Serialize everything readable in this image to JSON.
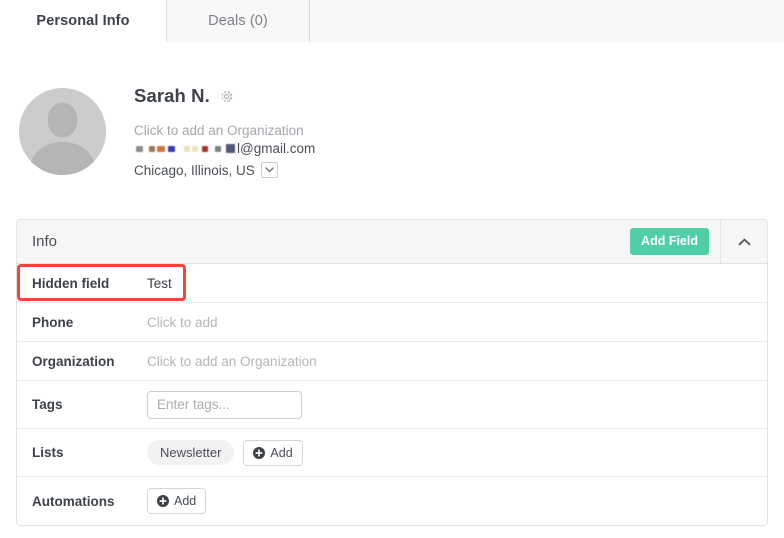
{
  "tabs": [
    {
      "label": "Personal Info",
      "active": true
    },
    {
      "label": "Deals (0)",
      "active": false
    }
  ],
  "profile": {
    "name": "Sarah N.",
    "settings_icon": "gear-icon",
    "organization_placeholder": "Click to add an Organization",
    "email_visible": "l@gmail.com",
    "location": "Chicago, Illinois, US",
    "location_caret_icon": "chevron-down-icon",
    "avatar_icon": "default-user-avatar"
  },
  "info_card": {
    "title": "Info",
    "add_field_label": "Add Field",
    "collapse_icon": "chevron-up-icon",
    "accent_color": "#4ecfa8",
    "highlight_color": "#f9423a",
    "rows": [
      {
        "label": "Hidden field",
        "value": "Test",
        "kind": "text",
        "highlighted": true
      },
      {
        "label": "Phone",
        "value": "Click to add",
        "kind": "placeholder"
      },
      {
        "label": "Organization",
        "value": "Click to add an Organization",
        "kind": "placeholder"
      },
      {
        "label": "Tags",
        "value": "",
        "placeholder": "Enter tags...",
        "kind": "input"
      },
      {
        "label": "Lists",
        "pill": "Newsletter",
        "add_label": "Add",
        "kind": "pills"
      },
      {
        "label": "Automations",
        "add_label": "Add",
        "kind": "add"
      }
    ]
  }
}
